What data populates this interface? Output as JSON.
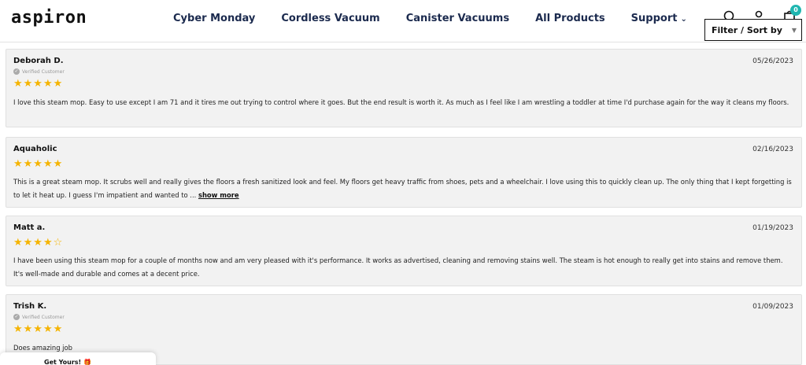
{
  "brand": {
    "logo_text": "aspiron"
  },
  "nav": {
    "items": [
      {
        "label": "Cyber Monday"
      },
      {
        "label": "Cordless Vacuum"
      },
      {
        "label": "Canister Vacuums"
      },
      {
        "label": "All Products"
      },
      {
        "label": "Support"
      }
    ]
  },
  "header": {
    "cart_count": "0"
  },
  "filter": {
    "label": "Filter / Sort by"
  },
  "reviews": [
    {
      "name": "Deborah D.",
      "date": "05/26/2023",
      "verified": "Verified Customer",
      "stars": "★★★★★",
      "text": "I love this steam mop.  Easy to use except I am 71 and it tires me out trying to control where it goes.  But the end result is worth it.  As much as I feel like I am wrestling a toddler at time I'd purchase again for the way it cleans my floors."
    },
    {
      "name": "Aquaholic",
      "date": "02/16/2023",
      "stars": "★★★★★",
      "text": "This is a great steam mop. It scrubs well and really gives the floors a fresh sanitized look and feel. My floors get heavy traffic from shoes, pets and a wheelchair. I love using this to quickly clean up. The only thing that I kept forgetting is to let it heat up. I guess I'm impatient and wanted to ...",
      "show_more": "show more"
    },
    {
      "name": "Matt a.",
      "date": "01/19/2023",
      "stars": "★★★★☆",
      "text": "I have been using this steam mop for a couple of months now and am very pleased with it's performance. It works as advertised, cleaning and removing stains well. The steam is hot enough to really get into stains and remove them. It's well-made and durable and comes at a decent price."
    },
    {
      "name": "Trish K.",
      "date": "01/09/2023",
      "verified": "Verified Customer",
      "stars": "★★★★★",
      "text": "Does amazing job"
    }
  ],
  "popup": {
    "label": "Get Yours!",
    "icon": "gift-icon"
  },
  "colors": {
    "star": "#f5b400",
    "nav": "#1b2a4e",
    "badge": "#1fb6b0",
    "card_bg": "#f2f2f2"
  }
}
